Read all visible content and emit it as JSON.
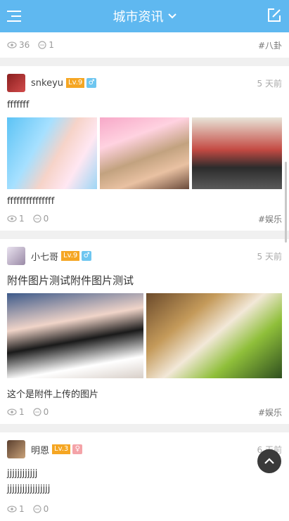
{
  "header": {
    "title": "城市资讯",
    "menu_icon": "menu-icon",
    "edit_icon": "edit-icon"
  },
  "posts": [
    {
      "views": "36",
      "comments": "1",
      "tag": "#八卦"
    },
    {
      "username": "snkeyu",
      "level": "Lv.9",
      "gender": "male",
      "time": "5 天前",
      "text": "fffffff",
      "caption": "fffffffffffffff",
      "views": "1",
      "comments": "0",
      "tag": "#娱乐"
    },
    {
      "username": "小七哥",
      "level": "Lv.9",
      "gender": "male",
      "time": "5 天前",
      "text": "附件图片测试附件图片测试",
      "caption": "这个是附件上传的图片",
      "views": "1",
      "comments": "0",
      "tag": "#娱乐"
    },
    {
      "username": "明恩",
      "level": "Lv.3",
      "gender": "female",
      "time": "6 天前",
      "line1": "jjjjjjjjjjjj",
      "line2": "jjjjjjjjjjjjjjjjj",
      "views": "1",
      "comments": "0"
    }
  ],
  "colors": {
    "header": "#5fb8f0",
    "level": "#f5a623",
    "male": "#6ec6f0",
    "female": "#f4a3a8"
  }
}
